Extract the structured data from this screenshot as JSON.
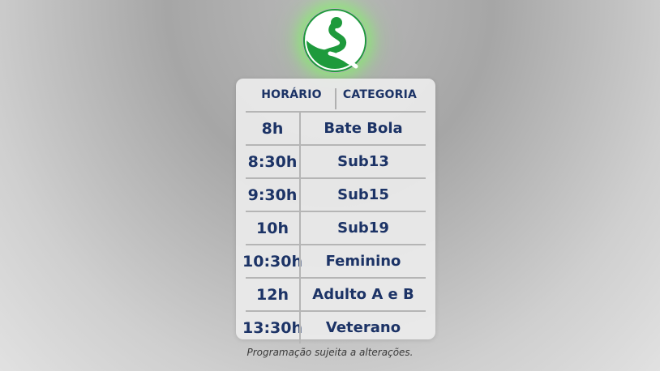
{
  "colors": {
    "text": "#1c3366",
    "logo_green": "#1e9a3c",
    "glow": "#7cff5a"
  },
  "logo": {
    "icon": "green-s-logo-icon"
  },
  "table": {
    "headers": [
      "HORÁRIO",
      "CATEGORIA"
    ],
    "rows": [
      [
        "8h",
        "Bate Bola"
      ],
      [
        "8:30h",
        "Sub13"
      ],
      [
        "9:30h",
        "Sub15"
      ],
      [
        "10h",
        "Sub19"
      ],
      [
        "10:30h",
        "Feminino"
      ],
      [
        "12h",
        "Adulto A e B"
      ],
      [
        "13:30h",
        "Veterano"
      ]
    ]
  },
  "footer_note": "Programação sujeita a alterações."
}
